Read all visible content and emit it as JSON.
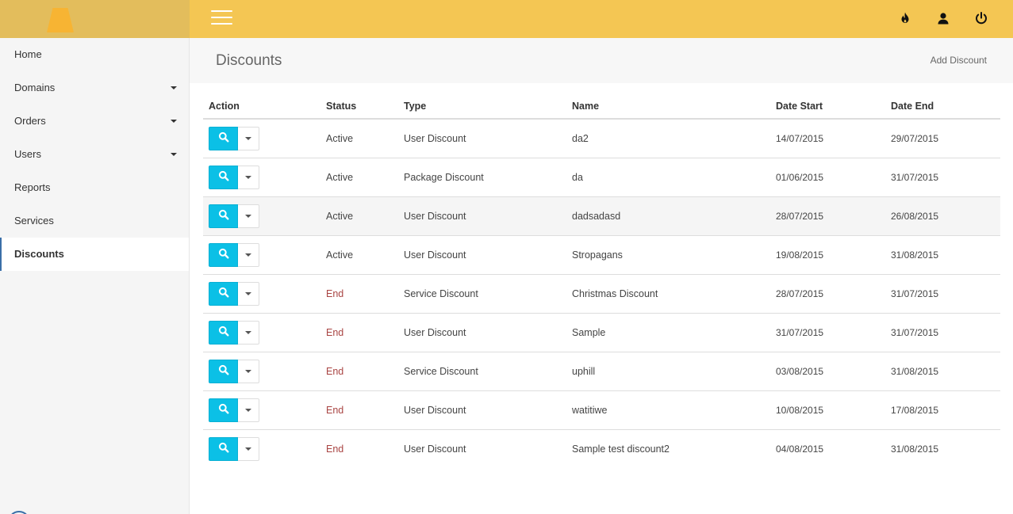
{
  "sidebar": {
    "items": [
      {
        "label": "Home",
        "has_caret": false,
        "active": false
      },
      {
        "label": "Domains",
        "has_caret": true,
        "active": false
      },
      {
        "label": "Orders",
        "has_caret": true,
        "active": false
      },
      {
        "label": "Users",
        "has_caret": true,
        "active": false
      },
      {
        "label": "Reports",
        "has_caret": false,
        "active": false
      },
      {
        "label": "Services",
        "has_caret": false,
        "active": false
      },
      {
        "label": "Discounts",
        "has_caret": false,
        "active": true
      }
    ]
  },
  "topbar": {
    "icons": [
      "fire-icon",
      "user-icon",
      "power-icon"
    ],
    "colors": {
      "bar": "#f4c653",
      "logo_area": "#e3bd5c",
      "logo": "#f7b433"
    }
  },
  "page": {
    "title": "Discounts",
    "add_label": "Add Discount"
  },
  "table": {
    "headers": {
      "action": "Action",
      "status": "Status",
      "type": "Type",
      "name": "Name",
      "date_start": "Date Start",
      "date_end": "Date End"
    },
    "rows": [
      {
        "status": "Active",
        "type": "User Discount",
        "name": "da2",
        "date_start": "14/07/2015",
        "date_end": "29/07/2015"
      },
      {
        "status": "Active",
        "type": "Package Discount",
        "name": "da",
        "date_start": "01/06/2015",
        "date_end": "31/07/2015"
      },
      {
        "status": "Active",
        "type": "User Discount",
        "name": "dadsadasd",
        "date_start": "28/07/2015",
        "date_end": "26/08/2015",
        "highlighted": true
      },
      {
        "status": "Active",
        "type": "User Discount",
        "name": "Stropagans",
        "date_start": "19/08/2015",
        "date_end": "31/08/2015"
      },
      {
        "status": "End",
        "type": "Service Discount",
        "name": "Christmas Discount",
        "date_start": "28/07/2015",
        "date_end": "31/07/2015"
      },
      {
        "status": "End",
        "type": "User Discount",
        "name": "Sample",
        "date_start": "31/07/2015",
        "date_end": "31/07/2015"
      },
      {
        "status": "End",
        "type": "Service Discount",
        "name": "uphill",
        "date_start": "03/08/2015",
        "date_end": "31/08/2015"
      },
      {
        "status": "End",
        "type": "User Discount",
        "name": "watitiwe",
        "date_start": "10/08/2015",
        "date_end": "17/08/2015"
      },
      {
        "status": "End",
        "type": "User Discount",
        "name": "Sample test discount2",
        "date_start": "04/08/2015",
        "date_end": "31/08/2015"
      }
    ],
    "colors": {
      "view_button": "#0bc0e6",
      "status_end": "#a94442"
    }
  }
}
